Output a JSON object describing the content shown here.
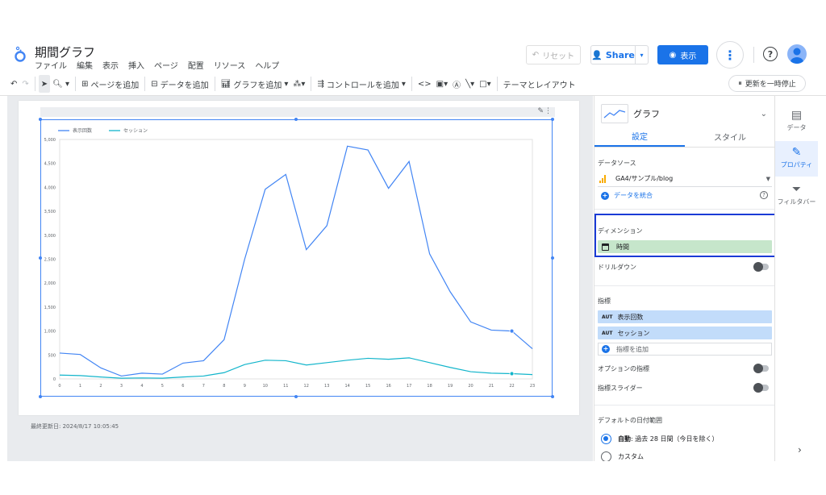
{
  "app": {
    "title": "期間グラフ",
    "menu": [
      "ファイル",
      "編集",
      "表示",
      "挿入",
      "ページ",
      "配置",
      "リソース",
      "ヘルプ"
    ]
  },
  "header": {
    "reset_label": "リセット",
    "share_label": "Share",
    "view_label": "表示",
    "accent": "#1a73e8"
  },
  "toolbar": {
    "add_page": "ページを追加",
    "add_data": "データを追加",
    "add_chart": "グラフを追加",
    "add_control": "コントロールを追加",
    "theme_layout": "テーマとレイアウト",
    "pause_updates": "更新を一時停止"
  },
  "canvas": {
    "last_updated": "最終更新日: 2024/8/17 10:05:45"
  },
  "chart_data": {
    "type": "line",
    "x": [
      0,
      1,
      2,
      3,
      4,
      5,
      6,
      7,
      8,
      9,
      10,
      11,
      12,
      13,
      14,
      15,
      16,
      17,
      18,
      19,
      20,
      21,
      22,
      23
    ],
    "xlabel": "",
    "ylabel": "",
    "ylim": [
      0,
      5000
    ],
    "yticks": [
      "0",
      "500",
      "1,000",
      "1,500",
      "2,000",
      "2,500",
      "3,000",
      "3,500",
      "4,000",
      "4,500",
      "5,000"
    ],
    "grid": false,
    "legend": "top-left",
    "series": [
      {
        "name": "表示回数",
        "color": "#4285f4",
        "values": [
          540,
          510,
          230,
          60,
          120,
          100,
          330,
          380,
          820,
          2500,
          3960,
          4270,
          2700,
          3200,
          4860,
          4780,
          3980,
          4540,
          2610,
          1820,
          1190,
          1020,
          1000,
          630
        ]
      },
      {
        "name": "セッション",
        "color": "#12b5cb",
        "values": [
          80,
          70,
          40,
          15,
          20,
          15,
          40,
          60,
          130,
          300,
          390,
          380,
          290,
          340,
          390,
          430,
          410,
          440,
          340,
          240,
          150,
          120,
          110,
          90
        ]
      }
    ]
  },
  "panel": {
    "chart_type_label": "グラフ",
    "tabs": [
      "設定",
      "スタイル"
    ],
    "data_source_label": "データソース",
    "data_source_name": "GA4/サンプル/blog",
    "blend_label": "データを統合",
    "dimension_label": "ディメンション",
    "dimension_chip": "時間",
    "drilldown_label": "ドリルダウン",
    "metrics_label": "指標",
    "metric_tag": "AUT",
    "metrics": [
      "表示回数",
      "セッション"
    ],
    "add_metric_label": "指標を追加",
    "optional_metrics_label": "オプションの指標",
    "metric_slider_label": "指標スライダー",
    "date_range_label": "デフォルトの日付範囲",
    "auto_label": "自動",
    "auto_detail": "過去 28 日間（今日を除く）",
    "custom_label": "カスタム"
  },
  "rail": {
    "data": "データ",
    "properties": "プロパティ",
    "filter": "フィルタバー"
  }
}
